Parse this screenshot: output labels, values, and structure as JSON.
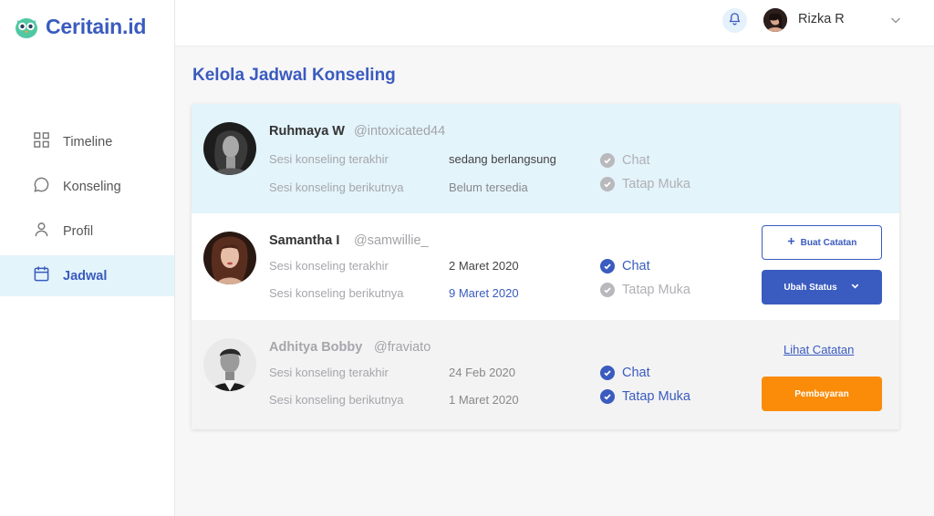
{
  "brand": {
    "name": "Ceritain.id"
  },
  "colors": {
    "accent": "#3a5bbf",
    "active_bg": "#e3f4fb",
    "orange": "#fa8c0a"
  },
  "sidebar": {
    "items": [
      {
        "label": "Timeline",
        "icon": "grid-icon",
        "active": false
      },
      {
        "label": "Konseling",
        "icon": "chat-bubble-icon",
        "active": false
      },
      {
        "label": "Profil",
        "icon": "user-icon",
        "active": false
      },
      {
        "label": "Jadwal",
        "icon": "calendar-icon",
        "active": true
      }
    ]
  },
  "header": {
    "user_name": "Rizka R",
    "notification_icon": "bell-icon",
    "menu_icon": "chevron-down-icon"
  },
  "page": {
    "title": "Kelola Jadwal Konseling"
  },
  "clients": [
    {
      "name": "Ruhmaya W",
      "handle": "@intoxicated44",
      "last_label": "Sesi konseling terakhir",
      "last_value": "sedang berlangsung",
      "next_label": "Sesi konseling berikutnya",
      "next_value": "Belum tersedia",
      "modes": [
        {
          "label": "Chat",
          "checked": false
        },
        {
          "label": "Tatap Muka",
          "checked": false
        }
      ]
    },
    {
      "name": "Samantha I",
      "handle": "@samwillie_",
      "last_label": "Sesi konseling terakhir",
      "last_value": "2 Maret 2020",
      "next_label": "Sesi konseling berikutnya",
      "next_value": "9 Maret 2020",
      "modes": [
        {
          "label": "Chat",
          "checked": true
        },
        {
          "label": "Tatap Muka",
          "checked": false
        }
      ],
      "actions": {
        "primary": "Buat Catatan",
        "secondary": "Ubah Status"
      }
    },
    {
      "name": "Adhitya Bobby",
      "handle": "@fraviato",
      "last_label": "Sesi konseling terakhir",
      "last_value": "24 Feb 2020",
      "next_label": "Sesi konseling berikutnya",
      "next_value": "1 Maret 2020",
      "modes": [
        {
          "label": "Chat",
          "checked": true
        },
        {
          "label": "Tatap Muka",
          "checked": true
        }
      ],
      "actions": {
        "link": "Lihat Catatan",
        "secondary": "Pembayaran"
      }
    }
  ]
}
